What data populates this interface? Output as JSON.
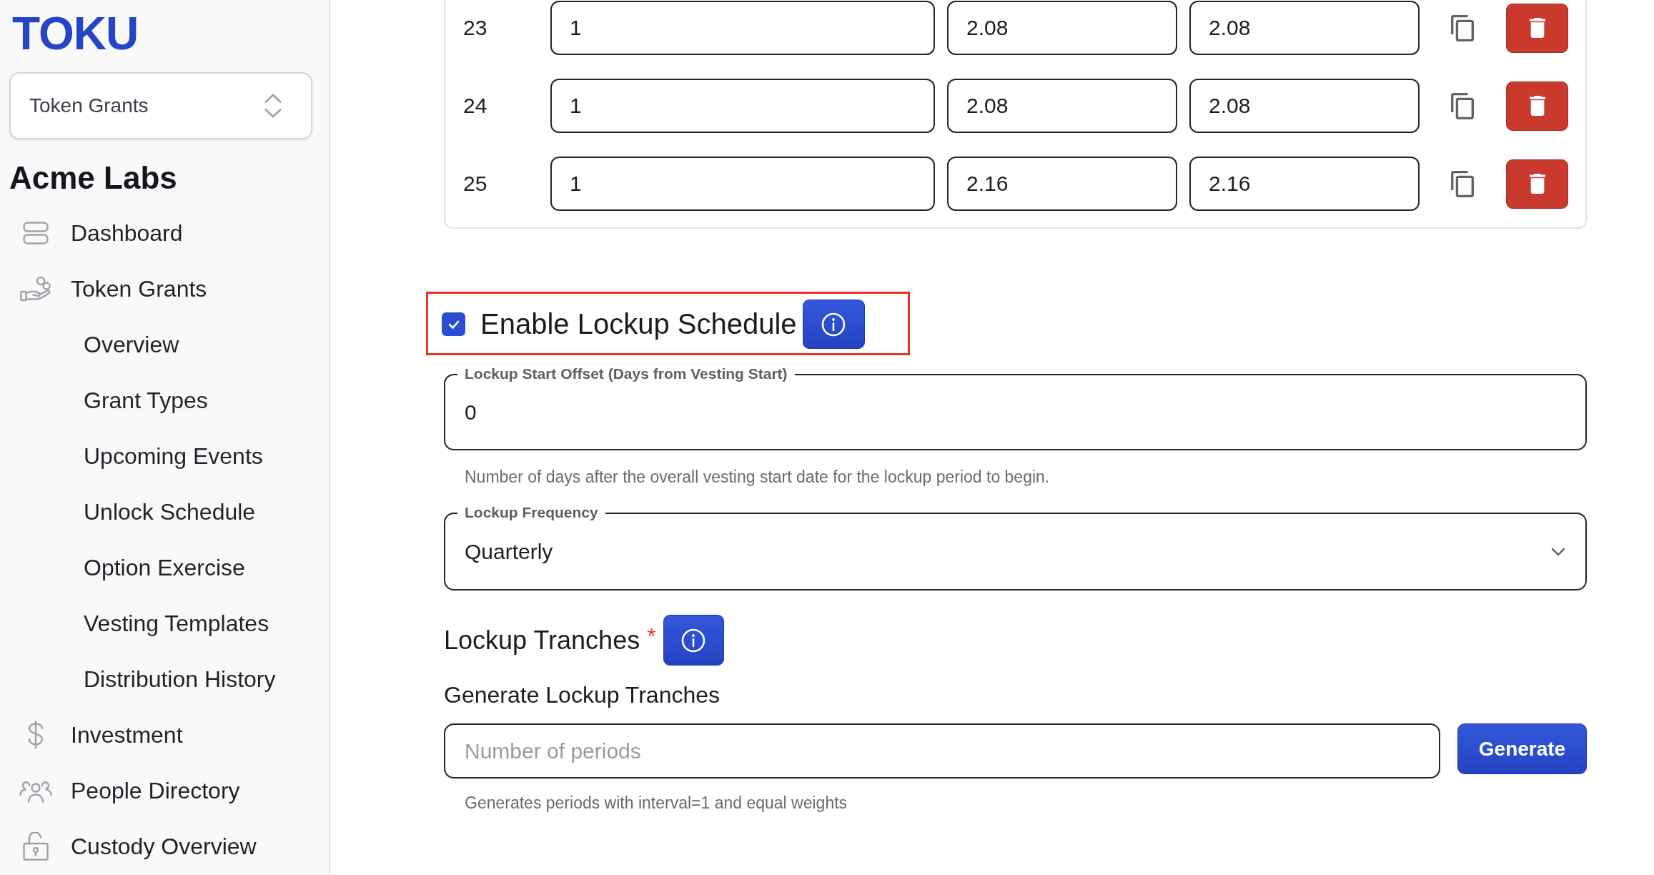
{
  "sidebar": {
    "logo": "TOKU",
    "product_switcher": {
      "value": "Token Grants"
    },
    "organization": "Acme Labs",
    "items": [
      {
        "label": "Dashboard"
      },
      {
        "label": "Token Grants",
        "children": [
          {
            "label": "Overview"
          },
          {
            "label": "Grant Types"
          },
          {
            "label": "Upcoming Events"
          },
          {
            "label": "Unlock Schedule"
          },
          {
            "label": "Option Exercise"
          },
          {
            "label": "Vesting Templates"
          },
          {
            "label": "Distribution History"
          }
        ]
      },
      {
        "label": "Investment"
      },
      {
        "label": "People Directory"
      },
      {
        "label": "Custody Overview"
      }
    ]
  },
  "tranche_rows": [
    {
      "number": "23",
      "values": [
        "1",
        "2.08",
        "2.08"
      ]
    },
    {
      "number": "24",
      "values": [
        "1",
        "2.08",
        "2.08"
      ]
    },
    {
      "number": "25",
      "values": [
        "1",
        "2.16",
        "2.16"
      ]
    }
  ],
  "enable_lockup": {
    "label": "Enable Lockup Schedule",
    "checked": true,
    "highlighted": true
  },
  "lockup_start_offset": {
    "label": "Lockup Start Offset (Days from Vesting Start)",
    "value": "0",
    "helper_text": "Number of days after the overall vesting start date for the lockup period to begin."
  },
  "lockup_frequency": {
    "label": "Lockup Frequency",
    "value": "Quarterly"
  },
  "lockup_tranches": {
    "title": "Lockup Tranches",
    "required_mark": "*",
    "generate_heading": "Generate Lockup Tranches",
    "periods_field": {
      "placeholder": "Number of periods"
    },
    "generate_button": {
      "label": "Generate"
    },
    "helper_text": "Generates periods with interval=1 and equal weights"
  }
}
